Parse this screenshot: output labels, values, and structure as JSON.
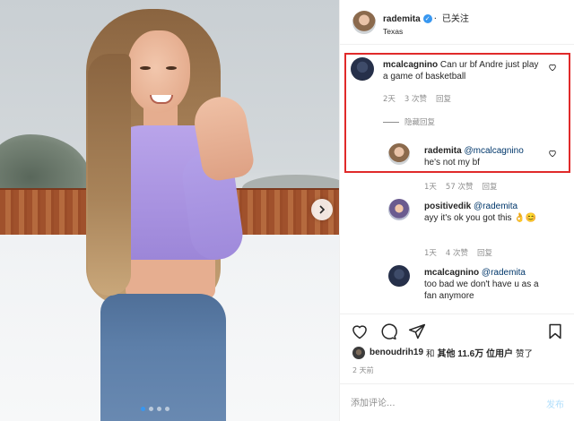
{
  "post": {
    "author": "rademita",
    "follow_label": "已关注",
    "location": "Texas"
  },
  "photo": {
    "carousel_total": 4,
    "carousel_active": 1,
    "icons": {
      "next": "chevron-right-icon"
    }
  },
  "comments": [
    {
      "username": "mcalcagnino",
      "text": "Can ur bf Andre just play a game of basketball",
      "meta": {
        "time": "2天",
        "likes": "3 次赞",
        "reply": "回复"
      },
      "hide_replies": "隐藏回复"
    },
    {
      "username": "rademita",
      "mention": "@mcalcagnino",
      "text": "he's not my bf",
      "meta": {
        "time": "1天",
        "likes": "57 次赞",
        "reply": "回复"
      }
    },
    {
      "username": "positivedik",
      "mention": "@rademita",
      "text": "ayy it's ok you got this 👌😊",
      "meta": {
        "time": "1天",
        "likes": "4 次赞",
        "reply": "回复"
      }
    },
    {
      "username": "mcalcagnino",
      "mention": "@rademita",
      "text": "too bad we don't have u as a fan anymore"
    }
  ],
  "likes_line": {
    "user": "benoudrih19",
    "and": "和",
    "others": "其他 11.6万 位用户",
    "liked": "赞了"
  },
  "time_ago": "2 天前",
  "add_comment": {
    "placeholder": "添加评论...",
    "post_label": "发布"
  },
  "colors": {
    "highlight": "#e02a2a",
    "accent": "#3897f0",
    "link": "#00376b",
    "muted": "#8e8e8e"
  }
}
